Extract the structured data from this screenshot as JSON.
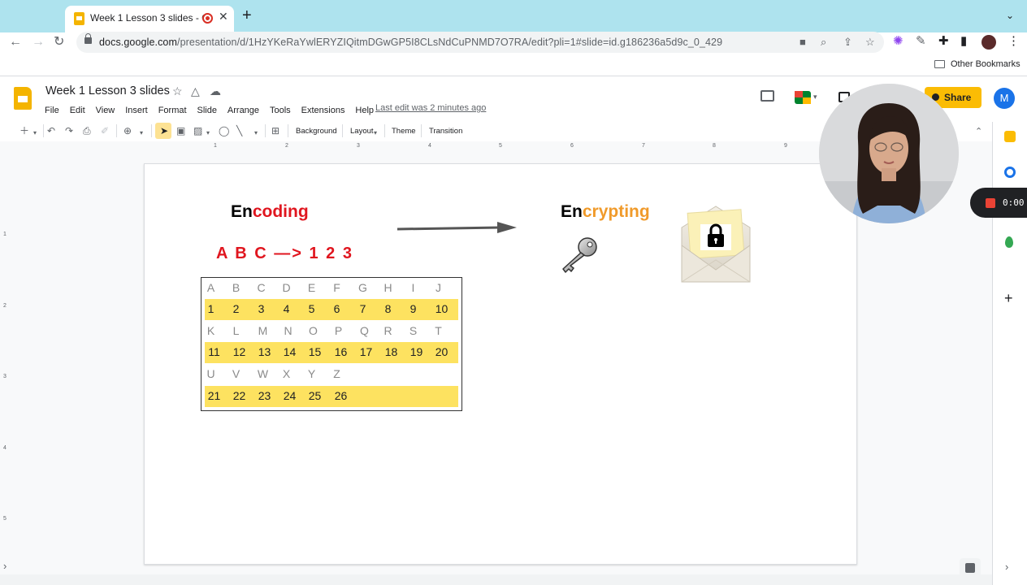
{
  "browser": {
    "tab_title": "Week 1 Lesson 3 slides - G",
    "tab_close": "✕",
    "new_tab": "+",
    "tab_menu": "⌄",
    "url_host": "docs.google.com",
    "url_path": "/presentation/d/1HzYKeRaYwlERYZIQitmDGwGP5I8CLsNdCuPNMD7O7RA/edit?pli=1#slide=id.g186236a5d9c_0_429",
    "bookmarks_label": "Other Bookmarks"
  },
  "app": {
    "doc_title": "Week 1 Lesson 3 slides",
    "menu": [
      "File",
      "Edit",
      "View",
      "Insert",
      "Format",
      "Slide",
      "Arrange",
      "Tools",
      "Extensions",
      "Help"
    ],
    "last_edit": "Last edit was 2 minutes ago",
    "share_label": "Share",
    "avatar_initial": "M"
  },
  "toolbar": {
    "background": "Background",
    "layout": "Layout",
    "theme": "Theme",
    "transition": "Transition"
  },
  "ruler": {
    "h_numbers": [
      "1",
      "2",
      "3",
      "4",
      "5",
      "6",
      "7",
      "8",
      "9"
    ],
    "v_numbers": [
      "1",
      "2",
      "3",
      "4",
      "5"
    ]
  },
  "slide": {
    "encoding_prefix": "En",
    "encoding_suffix": "coding",
    "encrypting_prefix": "En",
    "encrypting_suffix": "crypting",
    "mapping_line": "A B C —> 1 2 3",
    "cipher_table": [
      {
        "type": "letters",
        "cells": [
          "A",
          "B",
          "C",
          "D",
          "E",
          "F",
          "G",
          "H",
          "I",
          "J"
        ]
      },
      {
        "type": "numbers",
        "cells": [
          "1",
          "2",
          "3",
          "4",
          "5",
          "6",
          "7",
          "8",
          "9",
          "10"
        ]
      },
      {
        "type": "letters",
        "cells": [
          "K",
          "L",
          "M",
          "N",
          "O",
          "P",
          "Q",
          "R",
          "S",
          "T"
        ]
      },
      {
        "type": "numbers",
        "cells": [
          "11",
          "12",
          "13",
          "14",
          "15",
          "16",
          "17",
          "18",
          "19",
          "20"
        ]
      },
      {
        "type": "letters",
        "cells": [
          "U",
          "V",
          "W",
          "X",
          "Y",
          "Z"
        ]
      },
      {
        "type": "numbers",
        "cells": [
          "21",
          "22",
          "23",
          "24",
          "25",
          "26"
        ]
      }
    ]
  },
  "recording": {
    "timer": "0:00"
  },
  "colors": {
    "chrome_tab_strip": "#aee3ee",
    "slides_accent": "#fbbc04",
    "heading_red": "#e0161f",
    "heading_orange": "#f09a2a",
    "table_highlight": "#fde260"
  }
}
